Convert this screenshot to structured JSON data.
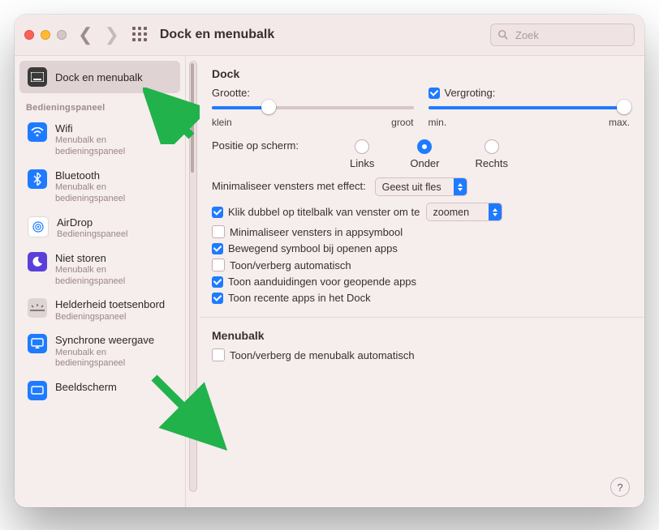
{
  "window": {
    "title": "Dock en menubalk",
    "search_placeholder": "Zoek"
  },
  "sidebar": {
    "selected": {
      "label": "Dock en menubalk"
    },
    "group_header": "Bedieningspaneel",
    "items": [
      {
        "name": "Wifi",
        "sub": "Menubalk en bedieningspaneel",
        "icon": "wifi",
        "bg": "#1e7bff"
      },
      {
        "name": "Bluetooth",
        "sub": "Menubalk en bedieningspaneel",
        "icon": "bluetooth",
        "bg": "#1e7bff"
      },
      {
        "name": "AirDrop",
        "sub": "Bedieningspaneel",
        "icon": "airdrop",
        "bg": "#ffffff"
      },
      {
        "name": "Niet storen",
        "sub": "Menubalk en bedieningspaneel",
        "icon": "moon",
        "bg": "#5b3fd9"
      },
      {
        "name": "Helderheid toetsenbord",
        "sub": "Bedieningspaneel",
        "icon": "keyboard-brightness",
        "bg": "#d9d0d0"
      },
      {
        "name": "Synchrone weergave",
        "sub": "Menubalk en bedieningspaneel",
        "icon": "screen-mirror",
        "bg": "#1e7bff"
      },
      {
        "name": "Beeldscherm",
        "sub": "",
        "icon": "display",
        "bg": "#1e7bff"
      }
    ]
  },
  "content": {
    "dock": {
      "title": "Dock",
      "size_label": "Grootte:",
      "size_min": "klein",
      "size_max": "groot",
      "size_value_pct": 28,
      "magnification_label": "Vergroting:",
      "magnification_checked": true,
      "mag_min": "min.",
      "mag_max": "max.",
      "mag_value_pct": 100,
      "position_label": "Positie op scherm:",
      "positions": [
        {
          "label": "Links",
          "selected": false
        },
        {
          "label": "Onder",
          "selected": true
        },
        {
          "label": "Rechts",
          "selected": false
        }
      ],
      "minimize_effect_label": "Minimaliseer vensters met effect:",
      "minimize_effect_value": "Geest uit fles",
      "doubleclick_prefix": "Klik dubbel op titelbalk van venster om te",
      "doubleclick_value": "zoomen",
      "doubleclick_checked": true,
      "options": [
        {
          "label": "Minimaliseer vensters in appsymbool",
          "checked": false
        },
        {
          "label": "Bewegend symbool bij openen apps",
          "checked": true
        },
        {
          "label": "Toon/verberg automatisch",
          "checked": false
        },
        {
          "label": "Toon aanduidingen voor geopende apps",
          "checked": true
        },
        {
          "label": "Toon recente apps in het Dock",
          "checked": true
        }
      ]
    },
    "menubar": {
      "title": "Menubalk",
      "auto_hide_label": "Toon/verberg de menubalk automatisch",
      "auto_hide_checked": false
    },
    "help_symbol": "?"
  }
}
